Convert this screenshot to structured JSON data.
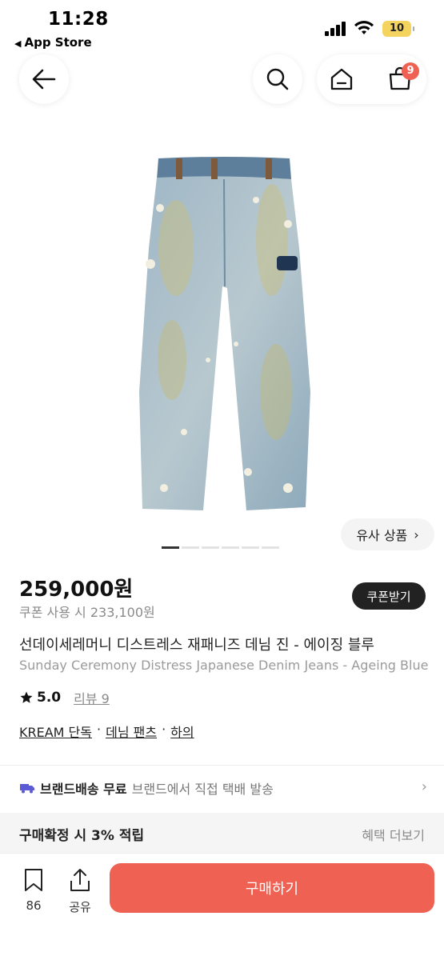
{
  "status_bar": {
    "time": "11:28",
    "back_label": "App Store",
    "battery": "10"
  },
  "nav": {
    "cart_count": "9"
  },
  "product": {
    "similar_label": "유사 상품",
    "gallery_total": 6,
    "gallery_active": 1,
    "price": "259,000원",
    "coupon_price": "쿠폰 사용 시 233,100원",
    "coupon_button": "쿠폰받기",
    "title_ko": "선데이세레머니 디스트레스 재패니즈 데님 진 - 에이징 블루",
    "title_en": "Sunday Ceremony Distress Japanese Denim Jeans - Ageing Blue",
    "rating": "5.0",
    "review_label": "리뷰 9",
    "breadcrumb": [
      "KREAM 단독",
      "데님 팬츠",
      "하의"
    ]
  },
  "delivery": {
    "strong": "브랜드배송 무료",
    "light": "브랜드에서 직접 택배 발송"
  },
  "benefit": {
    "label": "구매확정 시 3% 적립",
    "more": "혜택 더보기"
  },
  "bottom": {
    "bookmark_count": "86",
    "share_label": "공유",
    "buy_label": "구매하기"
  },
  "colors": {
    "accent": "#ef6253",
    "dark_button": "#222222",
    "delivery_icon": "#5b5bd6"
  }
}
